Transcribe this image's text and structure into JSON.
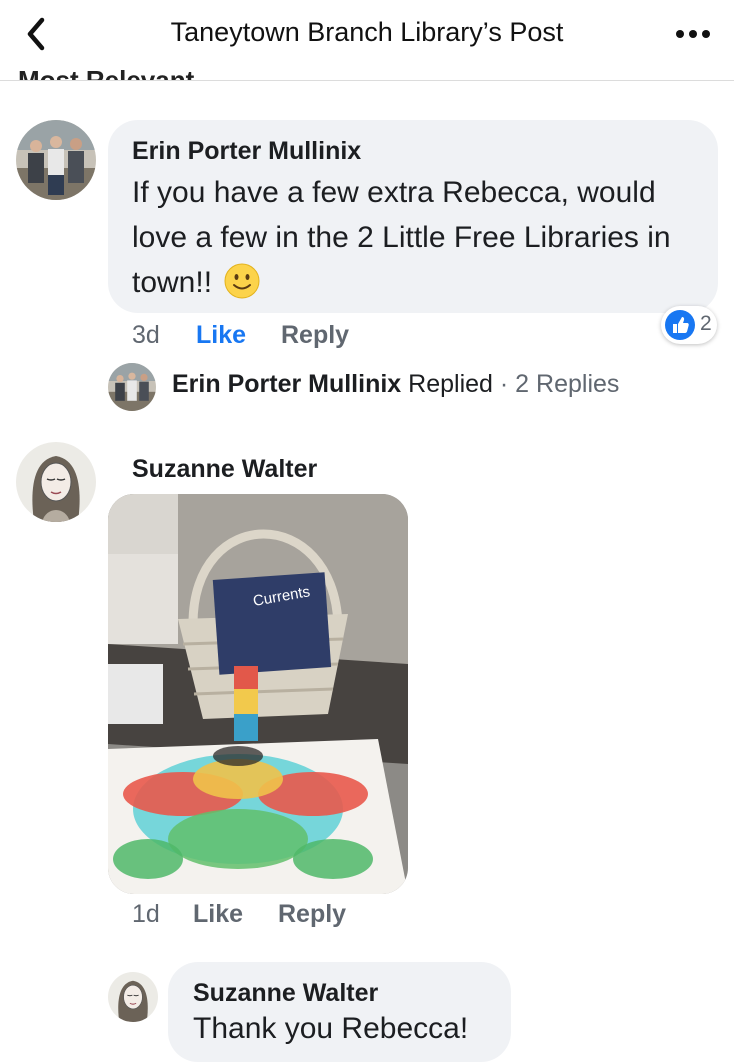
{
  "header": {
    "title": "Taneytown Branch Library’s Post",
    "sort_label": "Most Relevant"
  },
  "comments": [
    {
      "author": "Erin Porter Mullinix",
      "text": "If you have a few extra Rebecca, would love a few in the 2 Little Free Libraries in town!!",
      "emoji": "🙂",
      "time": "3d",
      "like_label": "Like",
      "reply_label": "Reply",
      "reaction_count": "2",
      "reply_summary": {
        "author": "Erin Porter Mullinix",
        "action": "Replied",
        "separator": "·",
        "count_label": "2 Replies"
      }
    },
    {
      "author": "Suzanne Walter",
      "image_text": "Currents",
      "time": "1d",
      "like_label": "Like",
      "reply_label": "Reply"
    }
  ],
  "replies": [
    {
      "author": "Suzanne Walter",
      "text": "Thank you Rebecca!"
    }
  ],
  "colors": {
    "accent": "#1877f2",
    "bubble": "#f0f2f5",
    "meta": "#606770"
  }
}
